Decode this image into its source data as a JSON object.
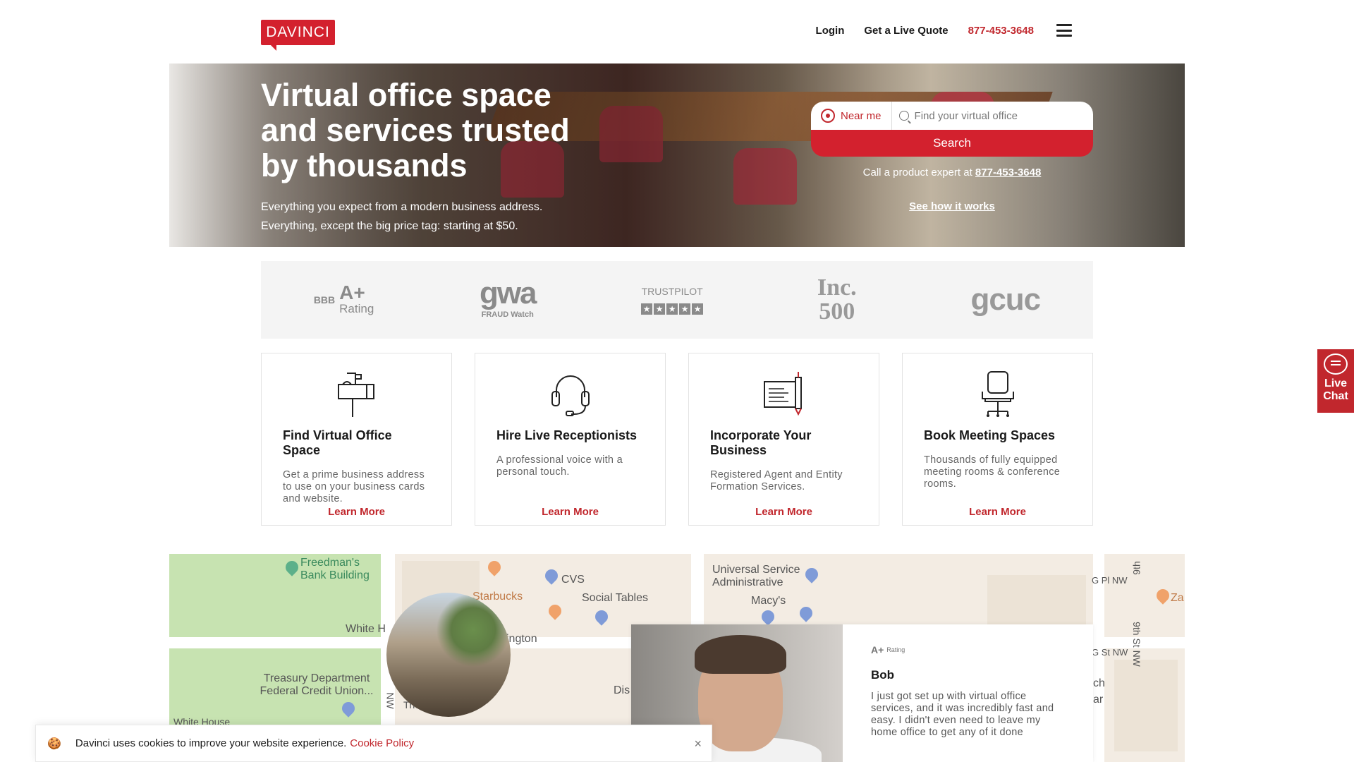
{
  "header": {
    "logo": "DAVINCI",
    "nav": {
      "login": "Login",
      "quote": "Get a Live Quote",
      "phone": "877-453-3648"
    }
  },
  "hero": {
    "title": "Virtual office space and services trusted by thousands",
    "subtitle_line1": "Everything you expect from a modern business address.",
    "subtitle_line2": "Everything, except the big price tag: starting at $50.",
    "near_me": "Near me",
    "search_placeholder": "Find your virtual office",
    "search_button": "Search",
    "call_text": "Call a product expert at",
    "call_phone": "877-453-3648",
    "how_link": "See how it works"
  },
  "trust": {
    "bbb_mark": "BBB",
    "bbb_grade": "A+",
    "bbb_rating": "Rating",
    "gwa": "gwa",
    "gwa_sub": "FRAUD Watch",
    "trustpilot": "TRUSTPILOT",
    "inc": "Inc. 500",
    "gcuc": "gcuc"
  },
  "cards": [
    {
      "title": "Find Virtual Office Space",
      "desc": "Get a prime business address to use on your business cards and website.",
      "link": "Learn More",
      "icon": "mailbox-icon"
    },
    {
      "title": "Hire Live Receptionists",
      "desc": "A professional voice with a personal touch.",
      "link": "Learn More",
      "icon": "headset-icon"
    },
    {
      "title": "Incorporate Your Business",
      "desc": "Registered Agent and Entity Formation Services.",
      "link": "Learn More",
      "icon": "document-pen-icon"
    },
    {
      "title": "Book Meeting Spaces",
      "desc": "Thousands of fully equipped meeting rooms & conference rooms.",
      "link": "Learn More",
      "icon": "office-chair-icon"
    }
  ],
  "live_chat": {
    "line1": "Live",
    "line2": "Chat"
  },
  "map": {
    "labels": {
      "freedmans": "Freedman's Bank Building",
      "cvs": "CVS",
      "starbucks": "Starbucks",
      "social_tables": "Social Tables",
      "universal": "Universal Service Administrative",
      "macys": "Macy's",
      "white_h": "White H",
      "ington": "ington",
      "treasury": "Treasury Department Federal Credit Union...",
      "white_house": "White House",
      "g_pl": "G Pl NW",
      "g_st": "G St NW",
      "ninth": "9th",
      "ninth_st": "9th St NW",
      "za": "Za",
      "dis": "Dis",
      "ch": "ch",
      "ar": "ar",
      "the": "The",
      "nw": "NW"
    }
  },
  "testimonial": {
    "badge": "A+",
    "badge_sub": "Rating",
    "name": "Bob",
    "quote": "I just got set up with virtual office services, and it was incredibly fast and easy. I didn't even need to leave my home office to get any of it done"
  },
  "cookie": {
    "text": "Davinci uses cookies to improve your website experience.",
    "link": "Cookie Policy",
    "close": "×"
  }
}
